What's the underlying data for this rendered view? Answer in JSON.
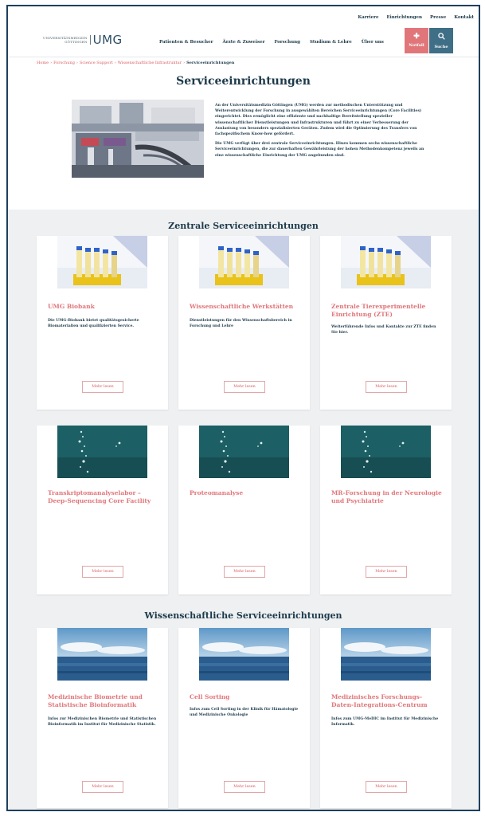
{
  "header": {
    "topnav": [
      "Karriere",
      "Einrichtungen",
      "Presse",
      "Kontakt"
    ],
    "logo_line1": "UNIVERSITÄTSMEDIZIN",
    "logo_line2": "GÖTTINGEN",
    "logo_umg": "UMG",
    "mainnav": [
      "Patienten & Besucher",
      "Ärzte & Zuweiser",
      "Forschung",
      "Studium & Lehre",
      "Über uns"
    ],
    "notfall_label": "Notfall",
    "suche_label": "Suche"
  },
  "breadcrumb": {
    "items": [
      "Home",
      "Forschung",
      "Science Support",
      "Wissenschaftliche Infrastruktur"
    ],
    "current": "Serviceeinrichtungen"
  },
  "page_title": "Serviceeinrichtungen",
  "intro": {
    "p1": "An der Universitätsmedizin Göttingen (UMG) werden zur methodischen Unterstützung und Weiterentwicklung der Forschung in ausgewählten Bereichen Serviceeinrichtungen (Core Facilities) eingerichtet. Dies ermöglicht eine effiziente und nachhaltige Bereitstellung spezieller wissenschaftlicher Dienstleistungen und Infrastrukturen und führt zu einer Verbesserung der Auslastung von besonders spezialisierten Geräten. Zudem wird die Optimierung des Transfers von fachspezifischem Know-how gefördert.",
    "p2": "Die UMG verfügt über drei zentrale Serviceeinrichtungen. Hinzu kommen sechs wissenschaftliche Serviceeinrichtungen, die zur dauerhaften Gewährleistung der hohen Methodenkompetenz jeweils an eine wissenschaftliche Einrichtung der UMG angebunden sind."
  },
  "sections": {
    "central_title": "Zentrale Serviceeinrichtungen",
    "science_title": "Wissenschaftliche Serviceeinrichtungen"
  },
  "more_label": "Mehr lesen",
  "cards": [
    {
      "title": "UMG Biobank",
      "desc": "Die UMG-Biobank bietet qualitätsgesicherte Biomaterialien und qualifizierten Service."
    },
    {
      "title": "Wissenschaftliche Werkstätten",
      "desc": "Dienstleistungen für den Wissenschaftsbereich in Forschung und Lehre"
    },
    {
      "title": "Zentrale Tierexperimentelle Einrichtung (ZTE)",
      "desc": "Weiterführende Infos und Kontakte zur ZTE finden Sie hier."
    },
    {
      "title": "Transkriptomanalyselabor – Deep-Sequencing Core Facility",
      "desc": ""
    },
    {
      "title": "Proteomanalyse",
      "desc": ""
    },
    {
      "title": "MR-Forschung in der Neurologie und Psychiatrie",
      "desc": ""
    },
    {
      "title": "Medizinische Biometrie und Statistische Bioinformatik",
      "desc": "Infos zur Medizinischen Biometrie und Statistischen Bioinformatik im Institut für Medizinische Statistik."
    },
    {
      "title": "Cell Sorting",
      "desc": "Infos zum Cell Sorting in der Klinik für Hämatologie und Medizinische Onkologie"
    },
    {
      "title": "Medizinisches Forschungs-Daten-Integrations-Centrum",
      "desc": "Infos zum UMG-MeDIC im Institut für Medizinische Informatik."
    }
  ]
}
